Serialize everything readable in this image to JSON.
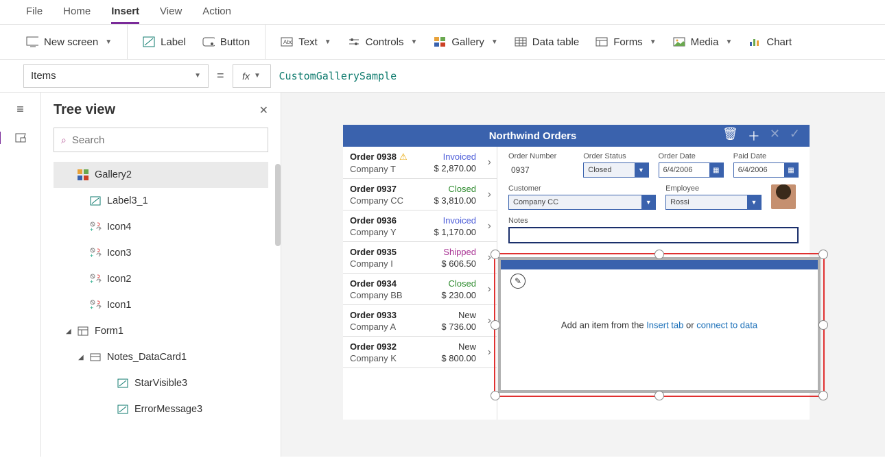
{
  "menu": {
    "file": "File",
    "home": "Home",
    "insert": "Insert",
    "view": "View",
    "action": "Action"
  },
  "ribbon": {
    "newScreen": "New screen",
    "label": "Label",
    "button": "Button",
    "text": "Text",
    "controls": "Controls",
    "gallery": "Gallery",
    "dataTable": "Data table",
    "forms": "Forms",
    "media": "Media",
    "chart": "Chart"
  },
  "formula": {
    "property": "Items",
    "expression": "CustomGallerySample"
  },
  "tree": {
    "title": "Tree view",
    "searchPlaceholder": "Search",
    "items": [
      "Gallery2",
      "Label3_1",
      "Icon4",
      "Icon3",
      "Icon2",
      "Icon1",
      "Form1",
      "Notes_DataCard1",
      "StarVisible3",
      "ErrorMessage3"
    ]
  },
  "app": {
    "title": "Northwind Orders",
    "orders": [
      {
        "id": "Order 0938",
        "warn": true,
        "company": "Company T",
        "status": "Invoiced",
        "statusClass": "st-invoiced",
        "price": "$ 2,870.00"
      },
      {
        "id": "Order 0937",
        "company": "Company CC",
        "status": "Closed",
        "statusClass": "st-closed",
        "price": "$ 3,810.00"
      },
      {
        "id": "Order 0936",
        "company": "Company Y",
        "status": "Invoiced",
        "statusClass": "st-invoiced",
        "price": "$ 1,170.00"
      },
      {
        "id": "Order 0935",
        "company": "Company I",
        "status": "Shipped",
        "statusClass": "st-shipped",
        "price": "$ 606.50"
      },
      {
        "id": "Order 0934",
        "company": "Company BB",
        "status": "Closed",
        "statusClass": "st-closed",
        "price": "$ 230.00"
      },
      {
        "id": "Order 0933",
        "company": "Company A",
        "status": "New",
        "statusClass": "st-new",
        "price": "$ 736.00"
      },
      {
        "id": "Order 0932",
        "company": "Company K",
        "status": "New",
        "statusClass": "st-new",
        "price": "$ 800.00"
      }
    ],
    "detail": {
      "orderNumberLabel": "Order Number",
      "orderNumber": "0937",
      "orderStatusLabel": "Order Status",
      "orderStatus": "Closed",
      "orderDateLabel": "Order Date",
      "orderDate": "6/4/2006",
      "paidDateLabel": "Paid Date",
      "paidDate": "6/4/2006",
      "customerLabel": "Customer",
      "customer": "Company CC",
      "employeeLabel": "Employee",
      "employee": "Rossi",
      "notesLabel": "Notes"
    },
    "placeholder": {
      "prefix": "Add an item from the ",
      "link1": "Insert tab",
      "mid": " or ",
      "link2": "connect to data"
    }
  }
}
